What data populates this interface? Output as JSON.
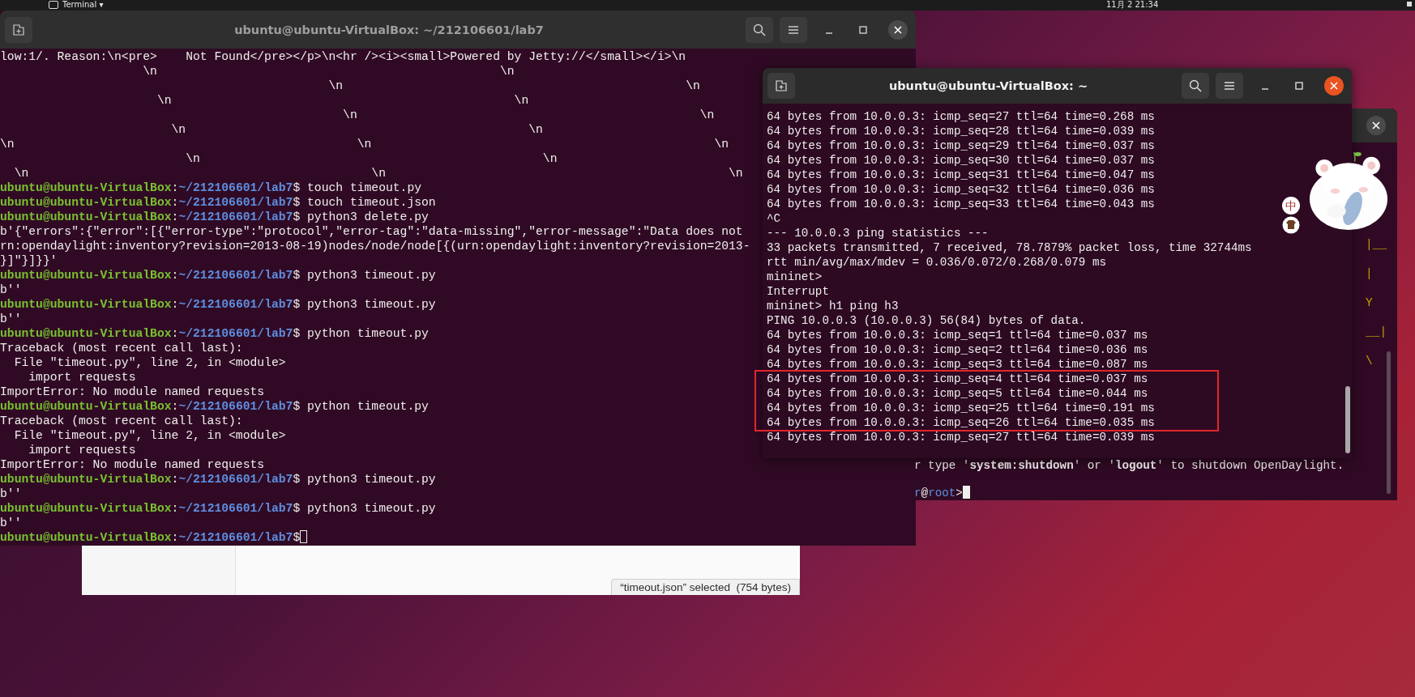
{
  "top_bar": {
    "app_menu": "Terminal ▾",
    "clock": "11月 2 21:34"
  },
  "file_manager": {
    "status": "“timeout.json” selected  (754 bytes)"
  },
  "terminal_back": {
    "focused": false,
    "art": [
      "|__",
      "|",
      "Y",
      "__|",
      "\\"
    ],
    "lines": [
      {
        "kind": "output",
        "text": "r type '**system:shutdown**' or '**logout**' to shutdown OpenDaylight."
      },
      {
        "kind": "karaf_prompt",
        "user": "r",
        "at": "@",
        "host": "root",
        "end": ">",
        "cursor": true
      }
    ]
  },
  "terminal_left": {
    "title": "ubuntu@ubuntu-VirtualBox: ~/212106601/lab7",
    "focused": false,
    "lines": [
      {
        "kind": "output",
        "text": "low:1/. Reason:\\n<pre>    Not Found</pre></p>\\n<hr /><i><small>Powered by Jetty://</small></i>\\n"
      },
      {
        "kind": "output",
        "text": "                    \\n                                                \\n"
      },
      {
        "kind": "output",
        "text": "                                              \\n                                                \\n"
      },
      {
        "kind": "output",
        "text": "                      \\n                                                \\n"
      },
      {
        "kind": "output",
        "text": "                                                \\n                                                \\n"
      },
      {
        "kind": "output",
        "text": "                        \\n                                                \\n"
      },
      {
        "kind": "output",
        "text": "\\n                                                \\n                                                \\n"
      },
      {
        "kind": "output",
        "text": "                          \\n                                                \\n"
      },
      {
        "kind": "output",
        "text": "  \\n                                                \\n                                                \\n"
      },
      {
        "kind": "prompt",
        "user": "ubuntu@ubuntu-VirtualBox",
        "sep": ":",
        "path": "~/212106601/lab7",
        "command": "$ touch timeout.py",
        "cursor": false
      },
      {
        "kind": "prompt",
        "user": "ubuntu@ubuntu-VirtualBox",
        "sep": ":",
        "path": "~/212106601/lab7",
        "command": "$ touch timeout.json",
        "cursor": false
      },
      {
        "kind": "prompt",
        "user": "ubuntu@ubuntu-VirtualBox",
        "sep": ":",
        "path": "~/212106601/lab7",
        "command": "$ python3 delete.py",
        "cursor": false
      },
      {
        "kind": "output",
        "text": "b'{\"errors\":{\"error\":[{\"error-type\":\"protocol\",\"error-tag\":\"data-missing\",\"error-message\":\"Data does not"
      },
      {
        "kind": "output",
        "text": "rn:opendaylight:inventory?revision=2013-08-19)nodes/node/node[{(urn:opendaylight:inventory?revision=2013-"
      },
      {
        "kind": "output",
        "text": "}]\"}]}}'"
      },
      {
        "kind": "prompt",
        "user": "ubuntu@ubuntu-VirtualBox",
        "sep": ":",
        "path": "~/212106601/lab7",
        "command": "$ python3 timeout.py",
        "cursor": false
      },
      {
        "kind": "output",
        "text": "b''"
      },
      {
        "kind": "prompt",
        "user": "ubuntu@ubuntu-VirtualBox",
        "sep": ":",
        "path": "~/212106601/lab7",
        "command": "$ python3 timeout.py",
        "cursor": false
      },
      {
        "kind": "output",
        "text": "b''"
      },
      {
        "kind": "prompt",
        "user": "ubuntu@ubuntu-VirtualBox",
        "sep": ":",
        "path": "~/212106601/lab7",
        "command": "$ python timeout.py",
        "cursor": false
      },
      {
        "kind": "output",
        "text": "Traceback (most recent call last):"
      },
      {
        "kind": "output",
        "text": "  File \"timeout.py\", line 2, in <module>"
      },
      {
        "kind": "output",
        "text": "    import requests"
      },
      {
        "kind": "output",
        "text": "ImportError: No module named requests"
      },
      {
        "kind": "prompt",
        "user": "ubuntu@ubuntu-VirtualBox",
        "sep": ":",
        "path": "~/212106601/lab7",
        "command": "$ python timeout.py",
        "cursor": false
      },
      {
        "kind": "output",
        "text": "Traceback (most recent call last):"
      },
      {
        "kind": "output",
        "text": "  File \"timeout.py\", line 2, in <module>"
      },
      {
        "kind": "output",
        "text": "    import requests"
      },
      {
        "kind": "output",
        "text": "ImportError: No module named requests"
      },
      {
        "kind": "prompt",
        "user": "ubuntu@ubuntu-VirtualBox",
        "sep": ":",
        "path": "~/212106601/lab7",
        "command": "$ python3 timeout.py",
        "cursor": false
      },
      {
        "kind": "output",
        "text": "b''"
      },
      {
        "kind": "prompt",
        "user": "ubuntu@ubuntu-VirtualBox",
        "sep": ":",
        "path": "~/212106601/lab7",
        "command": "$ python3 timeout.py",
        "cursor": false
      },
      {
        "kind": "output",
        "text": "b''"
      },
      {
        "kind": "prompt",
        "user": "ubuntu@ubuntu-VirtualBox",
        "sep": ":",
        "path": "~/212106601/lab7",
        "command": "$",
        "cursor": true
      }
    ]
  },
  "terminal_right": {
    "title": "ubuntu@ubuntu-VirtualBox: ~",
    "focused": true,
    "lines": [
      {
        "text": "64 bytes from 10.0.0.3: icmp_seq=27 ttl=64 time=0.268 ms",
        "highlighted": false
      },
      {
        "text": "64 bytes from 10.0.0.3: icmp_seq=28 ttl=64 time=0.039 ms",
        "highlighted": false
      },
      {
        "text": "64 bytes from 10.0.0.3: icmp_seq=29 ttl=64 time=0.037 ms",
        "highlighted": false
      },
      {
        "text": "64 bytes from 10.0.0.3: icmp_seq=30 ttl=64 time=0.037 ms",
        "highlighted": false
      },
      {
        "text": "64 bytes from 10.0.0.3: icmp_seq=31 ttl=64 time=0.047 ms",
        "highlighted": false
      },
      {
        "text": "64 bytes from 10.0.0.3: icmp_seq=32 ttl=64 time=0.036 ms",
        "highlighted": false
      },
      {
        "text": "64 bytes from 10.0.0.3: icmp_seq=33 ttl=64 time=0.043 ms",
        "highlighted": false
      },
      {
        "text": "^C",
        "highlighted": false
      },
      {
        "text": "--- 10.0.0.3 ping statistics ---",
        "highlighted": false
      },
      {
        "text": "33 packets transmitted, 7 received, 78.7879% packet loss, time 32744ms",
        "highlighted": false
      },
      {
        "text": "rtt min/avg/max/mdev = 0.036/0.072/0.268/0.079 ms",
        "highlighted": false
      },
      {
        "text": "mininet>",
        "highlighted": false
      },
      {
        "text": "Interrupt",
        "highlighted": false
      },
      {
        "text": "mininet> h1 ping h3",
        "highlighted": false
      },
      {
        "text": "PING 10.0.0.3 (10.0.0.3) 56(84) bytes of data.",
        "highlighted": false
      },
      {
        "text": "64 bytes from 10.0.0.3: icmp_seq=1 ttl=64 time=0.037 ms",
        "highlighted": false
      },
      {
        "text": "64 bytes from 10.0.0.3: icmp_seq=2 ttl=64 time=0.036 ms",
        "highlighted": false
      },
      {
        "text": "64 bytes from 10.0.0.3: icmp_seq=3 ttl=64 time=0.087 ms",
        "highlighted": false
      },
      {
        "text": "64 bytes from 10.0.0.3: icmp_seq=4 ttl=64 time=0.037 ms",
        "highlighted": true
      },
      {
        "text": "64 bytes from 10.0.0.3: icmp_seq=5 ttl=64 time=0.044 ms",
        "highlighted": true
      },
      {
        "text": "64 bytes from 10.0.0.3: icmp_seq=25 ttl=64 time=0.191 ms",
        "highlighted": true
      },
      {
        "text": "64 bytes from 10.0.0.3: icmp_seq=26 ttl=64 time=0.035 ms",
        "highlighted": true
      },
      {
        "text": "64 bytes from 10.0.0.3: icmp_seq=27 ttl=64 time=0.039 ms",
        "highlighted": false
      }
    ]
  },
  "input_method": {
    "indicator": "中"
  }
}
